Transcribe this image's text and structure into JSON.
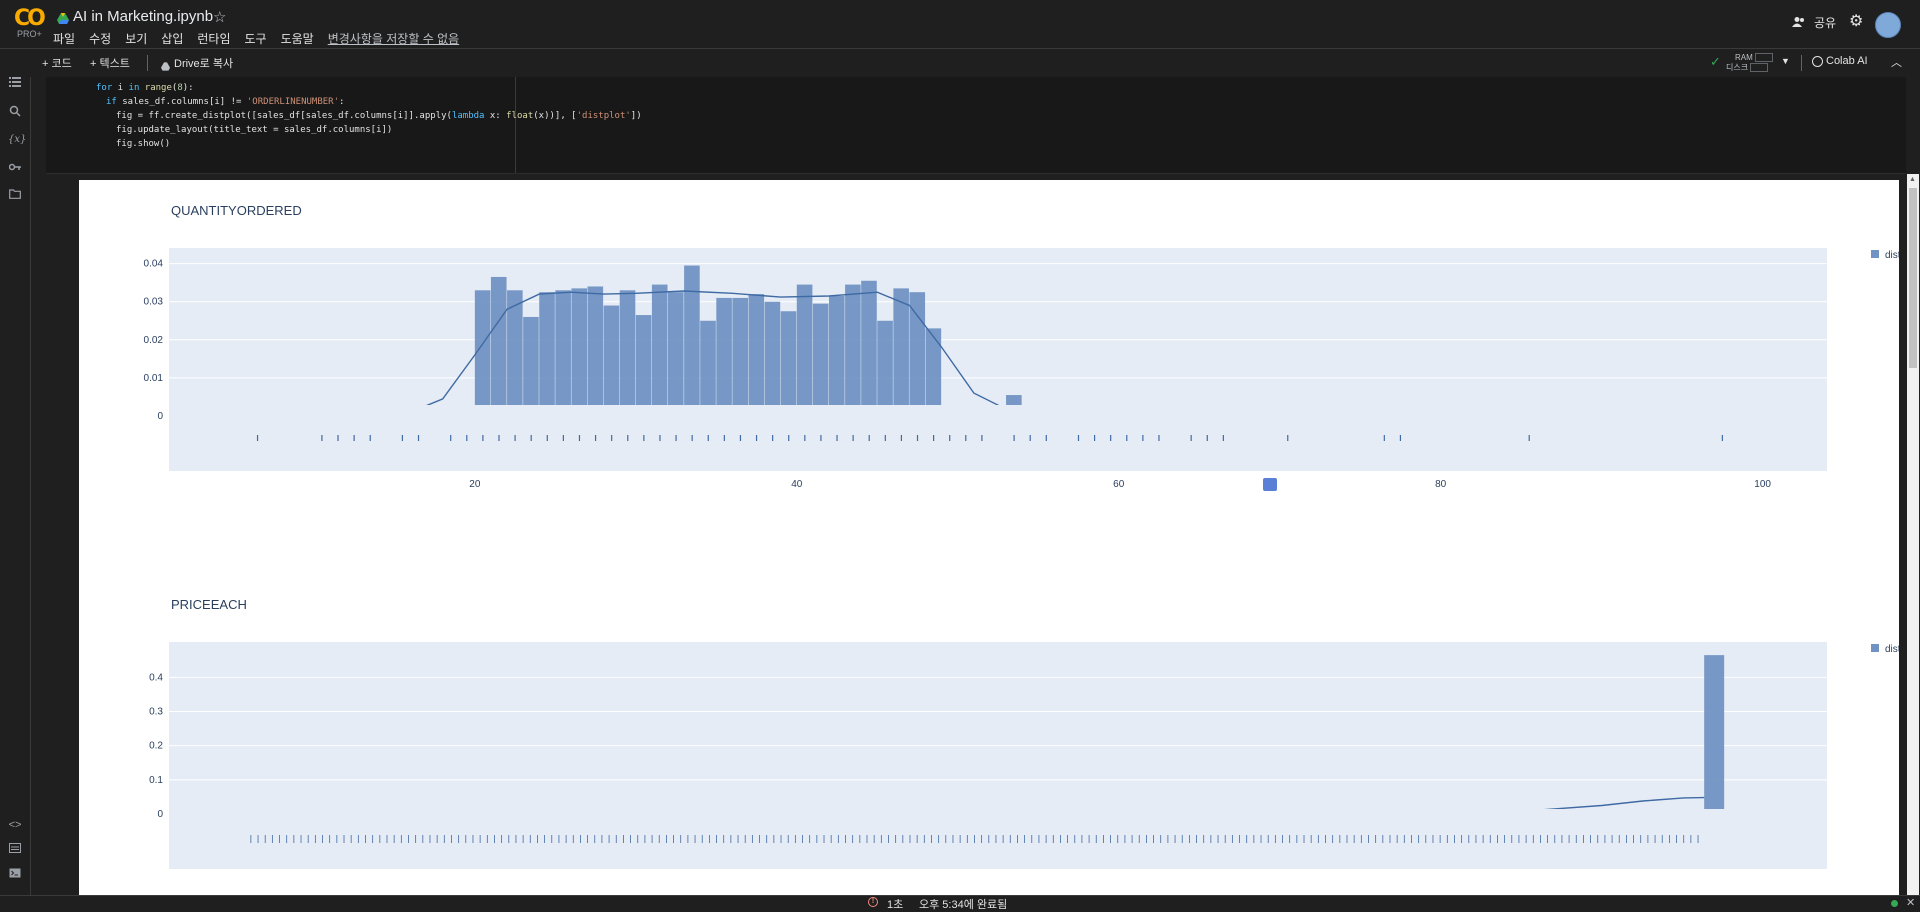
{
  "app": {
    "logo_text": "CO",
    "logo_sub": "PRO+",
    "notebook_title": "AI in Marketing.ipynb",
    "menus": [
      "파일",
      "수정",
      "보기",
      "삽입",
      "런타임",
      "도구",
      "도움말"
    ],
    "unsaved_notice": "변경사항을 저장할 수 없음",
    "share_label": "공유"
  },
  "toolbar": {
    "add_code": "+ 코드",
    "add_text": "+ 텍스트",
    "copy_drive": "Drive로 복사",
    "ram_label": "RAM",
    "disk_label": "디스크",
    "colab_ai": "Colab AI"
  },
  "code_lines": [
    "for i in range(8):",
    "  if sales_df.columns[i] != 'ORDERLINENUMBER':",
    "    fig = ff.create_distplot([sales_df[sales_df.columns[i]].apply(lambda x: float(x))], ['distplot'])",
    "    fig.update_layout(title_text = sales_df.columns[i])",
    "    fig.show()"
  ],
  "status": {
    "elapsed": "1초",
    "completed": "오후 5:34에 완료됨"
  },
  "colors": {
    "bar": "#7193c3",
    "line": "#3f6aa3",
    "plot_bg": "#e5ecf6",
    "rug": "#3f6aa3"
  },
  "chart_data": [
    {
      "type": "bar",
      "title": "QUANTITYORDERED",
      "legend": "distplot",
      "legend_position": "top-right",
      "x_ticks": [
        20,
        40,
        60,
        80,
        100
      ],
      "y_ticks": [
        "0",
        "0.01",
        "0.02",
        "0.03",
        "0.04"
      ],
      "xlim": [
        1,
        104
      ],
      "ylim": [
        0,
        0.042
      ],
      "bin_width": 1,
      "bars": [
        [
          6,
          0.0006
        ],
        [
          10,
          0.0004
        ],
        [
          11,
          0.0004
        ],
        [
          12,
          0.0004
        ],
        [
          13,
          0.0004
        ],
        [
          15,
          0.0012
        ],
        [
          16,
          0.0004
        ],
        [
          18,
          0.0008
        ],
        [
          19,
          0.0008
        ],
        [
          20,
          0.033
        ],
        [
          21,
          0.0365
        ],
        [
          22,
          0.033
        ],
        [
          23,
          0.026
        ],
        [
          24,
          0.0325
        ],
        [
          25,
          0.033
        ],
        [
          26,
          0.0335
        ],
        [
          27,
          0.034
        ],
        [
          28,
          0.029
        ],
        [
          29,
          0.033
        ],
        [
          30,
          0.0265
        ],
        [
          31,
          0.0345
        ],
        [
          32,
          0.0325
        ],
        [
          33,
          0.0395
        ],
        [
          34,
          0.025
        ],
        [
          35,
          0.031
        ],
        [
          36,
          0.031
        ],
        [
          37,
          0.032
        ],
        [
          38,
          0.03
        ],
        [
          39,
          0.0275
        ],
        [
          40,
          0.0345
        ],
        [
          41,
          0.0295
        ],
        [
          42,
          0.0315
        ],
        [
          43,
          0.0345
        ],
        [
          44,
          0.0355
        ],
        [
          45,
          0.025
        ],
        [
          46,
          0.0335
        ],
        [
          47,
          0.0325
        ],
        [
          48,
          0.023
        ],
        [
          49,
          0.0015
        ],
        [
          50,
          0.0006
        ],
        [
          52,
          0.0008
        ],
        [
          53,
          0.0055
        ],
        [
          54,
          0.001
        ],
        [
          56,
          0.0005
        ],
        [
          57,
          0.0006
        ],
        [
          58,
          0.0006
        ],
        [
          59,
          0.0006
        ],
        [
          60,
          0.0005
        ],
        [
          62,
          0.0008
        ],
        [
          63,
          0.0006
        ],
        [
          64,
          0.0018
        ],
        [
          67,
          0.0005
        ],
        [
          70,
          0.0004
        ],
        [
          76,
          0.0008
        ],
        [
          77,
          0.0004
        ],
        [
          85,
          0.0004
        ],
        [
          97,
          0.0004
        ]
      ],
      "kde": [
        [
          6,
          0.0003
        ],
        [
          12,
          0.0004
        ],
        [
          16,
          0.001
        ],
        [
          18,
          0.0045
        ],
        [
          20,
          0.016
        ],
        [
          22,
          0.028
        ],
        [
          24,
          0.032
        ],
        [
          26,
          0.0325
        ],
        [
          28,
          0.032
        ],
        [
          30,
          0.0322
        ],
        [
          33,
          0.0328
        ],
        [
          36,
          0.0322
        ],
        [
          39,
          0.0312
        ],
        [
          42,
          0.0315
        ],
        [
          45,
          0.0325
        ],
        [
          47,
          0.029
        ],
        [
          49,
          0.018
        ],
        [
          51,
          0.006
        ],
        [
          53,
          0.0018
        ],
        [
          56,
          0.0012
        ],
        [
          60,
          0.0009
        ],
        [
          65,
          0.0008
        ],
        [
          70,
          0.0006
        ],
        [
          80,
          0.0004
        ],
        [
          97,
          0.0003
        ]
      ],
      "rug": [
        6,
        10,
        11,
        12,
        13,
        15,
        16,
        18,
        19,
        20,
        21,
        22,
        23,
        24,
        25,
        26,
        27,
        28,
        29,
        30,
        31,
        32,
        33,
        34,
        35,
        36,
        37,
        38,
        39,
        40,
        41,
        42,
        43,
        44,
        45,
        46,
        47,
        48,
        49,
        50,
        51,
        53,
        54,
        55,
        57,
        58,
        59,
        60,
        61,
        62,
        64,
        65,
        66,
        70,
        76,
        77,
        85,
        97
      ]
    },
    {
      "type": "bar",
      "title": "PRICEEACH",
      "legend": "distplot",
      "legend_position": "top-right",
      "x_ticks": [],
      "y_ticks": [
        "0",
        "0.1",
        "0.2",
        "0.3",
        "0.4"
      ],
      "xlim": [
        23,
        104
      ],
      "ylim": [
        0,
        0.48
      ],
      "bin_width": 1,
      "bars": [
        [
          30,
          0.001
        ],
        [
          45,
          0.002
        ],
        [
          55,
          0.002
        ],
        [
          65,
          0.002
        ],
        [
          75,
          0.003
        ],
        [
          85,
          0.003
        ],
        [
          90,
          0.003
        ],
        [
          95,
          0.004
        ],
        [
          98,
          0.465
        ]
      ],
      "kde": [
        [
          27,
          0.0
        ],
        [
          40,
          0.002
        ],
        [
          50,
          0.004
        ],
        [
          60,
          0.005
        ],
        [
          70,
          0.006
        ],
        [
          80,
          0.006
        ],
        [
          87,
          0.007
        ],
        [
          90,
          0.012
        ],
        [
          93,
          0.025
        ],
        [
          95,
          0.038
        ],
        [
          97,
          0.047
        ],
        [
          98,
          0.048
        ]
      ],
      "rug_range": [
        27,
        98
      ]
    }
  ]
}
